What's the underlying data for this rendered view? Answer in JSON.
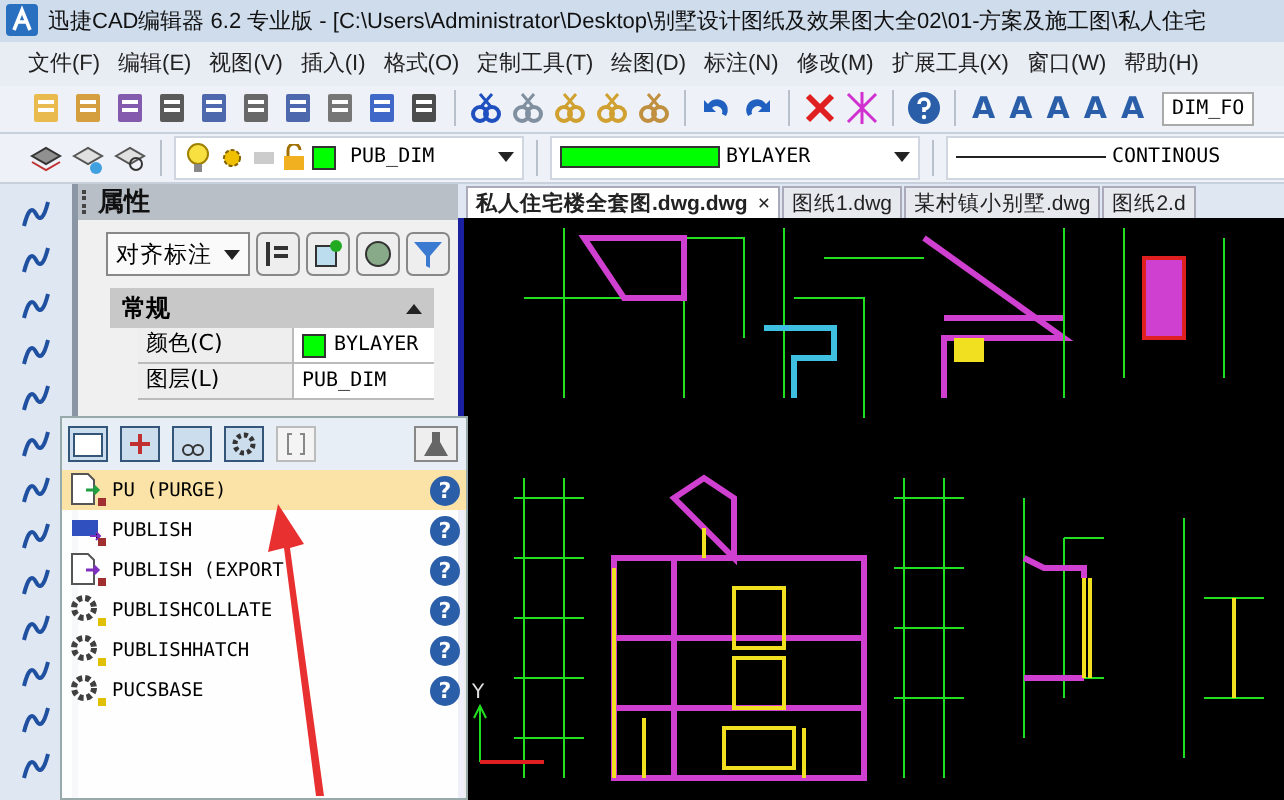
{
  "window": {
    "title": "迅捷CAD编辑器 6.2 专业版  - [C:\\Users\\Administrator\\Desktop\\别墅设计图纸及效果图大全02\\01-方案及施工图\\私人住宅"
  },
  "menu": [
    "文件(F)",
    "编辑(E)",
    "视图(V)",
    "插入(I)",
    "格式(O)",
    "定制工具(T)",
    "绘图(D)",
    "标注(N)",
    "修改(M)",
    "扩展工具(X)",
    "窗口(W)",
    "帮助(H)"
  ],
  "toolbar": {
    "text_style_buttons": [
      "A",
      "A",
      "A",
      "A",
      "A"
    ],
    "dim_style": "DIM_FO"
  },
  "layer_bar": {
    "layer": {
      "name": "PUB_DIM",
      "color": "#00ff00"
    },
    "color": {
      "label": "BYLAYER",
      "color": "#00ff00"
    },
    "linetype": {
      "label": "CONTINOUS"
    }
  },
  "properties": {
    "title": "属性",
    "object_type": "对齐标注",
    "section": {
      "label": "常规",
      "expanded": true
    },
    "rows": [
      {
        "label": "颜色(C)",
        "value": "BYLAYER",
        "color": "#00ff00"
      },
      {
        "label": "图层(L)",
        "value": "PUB_DIM"
      }
    ]
  },
  "autocomplete": {
    "items": [
      {
        "label": "PU (PURGE)",
        "kind": "doc",
        "selected": true,
        "help": "?"
      },
      {
        "label": "PUBLISH",
        "kind": "print",
        "selected": false,
        "help": "?"
      },
      {
        "label": "PUBLISH (EXPORT",
        "kind": "export",
        "selected": false,
        "help": "?"
      },
      {
        "label": "PUBLISHCOLLATE",
        "kind": "gear",
        "selected": false,
        "help": "?"
      },
      {
        "label": "PUBLISHHATCH",
        "kind": "gear",
        "selected": false,
        "help": "?"
      },
      {
        "label": "PUCSBASE",
        "kind": "gear",
        "selected": false,
        "help": "?"
      }
    ]
  },
  "tabs": [
    {
      "label": "私人住宅楼全套图.dwg.dwg",
      "selected": true,
      "close": "×"
    },
    {
      "label": "图纸1.dwg",
      "selected": false
    },
    {
      "label": "某村镇小别墅.dwg",
      "selected": false
    },
    {
      "label": "图纸2.d",
      "selected": false
    }
  ],
  "canvas": {
    "ucs_label": "Y"
  }
}
